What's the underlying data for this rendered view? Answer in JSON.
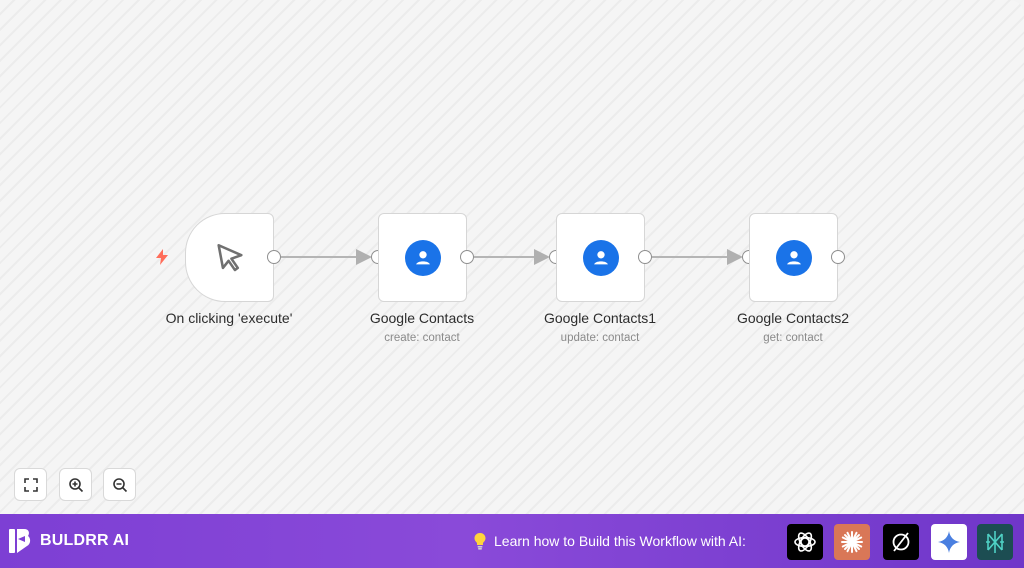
{
  "workflow": {
    "nodes": [
      {
        "title": "On clicking 'execute'",
        "subtitle": ""
      },
      {
        "title": "Google Contacts",
        "subtitle": "create: contact"
      },
      {
        "title": "Google Contacts1",
        "subtitle": "update: contact"
      },
      {
        "title": "Google Contacts2",
        "subtitle": "get: contact"
      }
    ]
  },
  "controls": {
    "icons": [
      "fit-view-icon",
      "zoom-in-icon",
      "zoom-out-icon"
    ]
  },
  "footer": {
    "brand": "BULDRR AI",
    "learn_text": "Learn how to Build this Workflow with AI:",
    "ai_tools": [
      "chatgpt-icon",
      "claude-icon",
      "perplexity-icon",
      "gemini-icon",
      "deepseek-icon"
    ]
  },
  "colors": {
    "footer_gradient_start": "#7d3fd4",
    "footer_gradient_end": "#6f36c9",
    "google_contacts_blue": "#1a73e8",
    "trigger_bolt": "#ff6d5a"
  }
}
